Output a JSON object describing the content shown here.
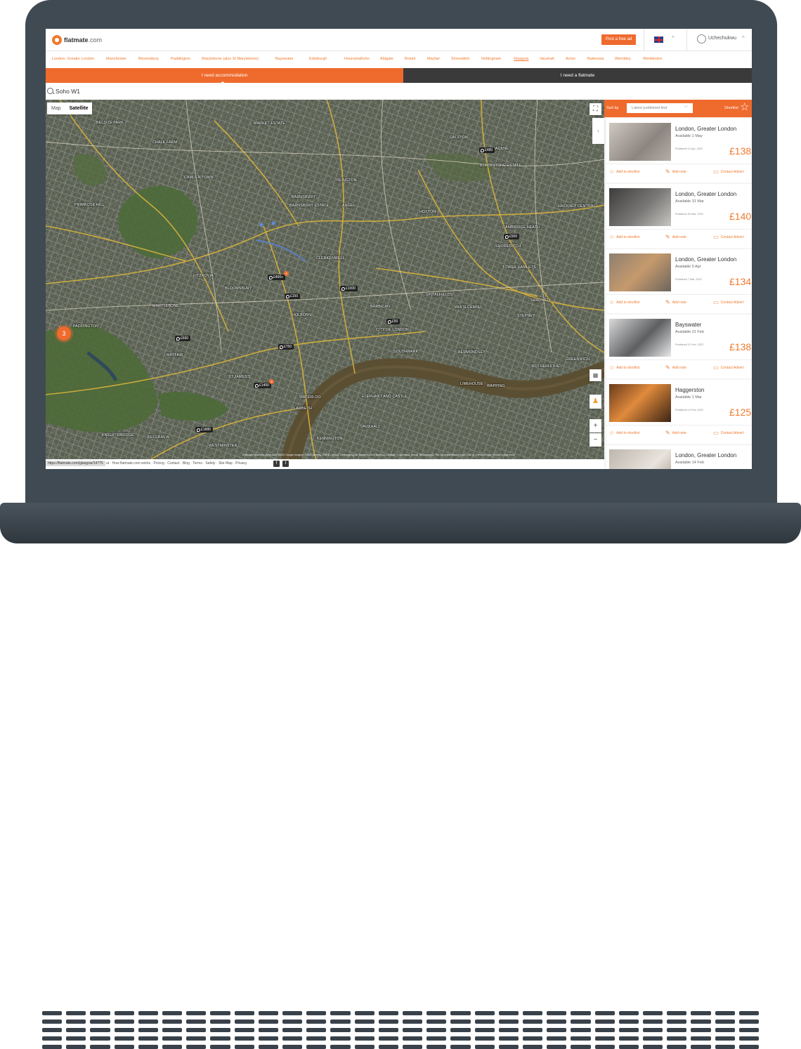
{
  "header": {
    "logo_text": "flatmate",
    "logo_suffix": ".com",
    "post_ad_label": "Post a free ad",
    "user_name": "Uchechukwu"
  },
  "cities": [
    "London, Greater London",
    "Manchester",
    "Bloomsbury",
    "Paddington",
    "Marylebone (also St Marylebone)",
    "Bayswater",
    "Edinburgh",
    "Hounslow",
    "Soho",
    "Aldgate",
    "Bristol",
    "Mayfair",
    "Shoreditch",
    "Nottingham",
    "Glasgow",
    "Vauxhall",
    "Acton",
    "Battersea",
    "Wembley",
    "Wimbledon"
  ],
  "tabs": {
    "accommodation": "I need accommodation",
    "flatmate": "I need a flatmate"
  },
  "search": {
    "value": "Soho  W1"
  },
  "map": {
    "type_map": "Map",
    "type_satellite": "Satellite",
    "cluster_count": "3",
    "zoom_in": "+",
    "zoom_out": "−",
    "labels": [
      "BELSIZE PARK",
      "MARKET ESTATE",
      "CHALK FARM",
      "DALSTON",
      "HACKNE",
      "CAMDEN TOWN",
      "BARNSBURY",
      "ISLINGTON",
      "PRIMROSE HILL",
      "CAMBRIDGE HEATH",
      "BARNSBURY ESTATE",
      "ANGEL",
      "HOXTON",
      "BLACKSTONE ESTATE",
      "SHOREDITCH",
      "CLERKENWELL",
      "FITZROVIA",
      "BLOOMSBURY",
      "MARYLEBONE",
      "HOLBORN",
      "BARBICAN",
      "SPITALFIELDS",
      "WHITECHAPEL",
      "STEPNEY",
      "PADDINGTON",
      "MAYFAIR",
      "ST JAMES'S",
      "SOUTHWARK",
      "BERMONDSEY",
      "ROTHERHITHE",
      "WATERLOO",
      "LAMBETH",
      "KNIGHTSBRIDGE",
      "BELGRAVIA",
      "KENNINGTON",
      "VAUXHALL",
      "WESTMINSTER",
      "LIMEHOUSE",
      "WAPPING",
      "CITY OF LONDON",
      "ELEPHANT AND CASTLE",
      "TOWER HAMLETS",
      "SHADWELL",
      "GREENWICH",
      "HACKNEY CENTRAL"
    ],
    "pins": [
      "£480",
      "£500",
      "£400+",
      "£1000",
      "£150",
      "£50",
      "£690",
      "£750",
      "£1400",
      "£1880"
    ],
    "pin_badges": [
      "9",
      "8"
    ],
    "attribution": "Keyboard shortcuts  |  Map data ©2022 Google  Imagery ©2022  Bluesky, CNES / Airbus, Getmapping plc, Infoterra Ltd & Bluesky, Landsat / Copernicus, Maxar Technologies, The GeoInformation Group  |  200 m  |  Terms of Use  |  Report a map error"
  },
  "footer": {
    "status_url": "https://flatmate.com/glasgow/14775",
    "links": "ut  ·  How flatmate.com works  ·  Pricing  ·  Contact  ·  Blog  ·  Terms  ·  Safety  ·  Site Map  ·  Privacy"
  },
  "sidebar": {
    "sort_by": "Sort by",
    "sort_value": "Latest published first",
    "shortlist_label": "Shortlist",
    "collapse": "‹",
    "action_shortlist": "Add to shortlist",
    "action_note": "Add note",
    "action_contact": "Contact Advert",
    "listings": [
      {
        "title": "London, Greater London",
        "available": "Available 1 May",
        "published": "Published 12 Apr, 2022",
        "price": "£138"
      },
      {
        "title": "London, Greater London",
        "available": "Available 31 Mar",
        "published": "Published 30 Mar, 2022",
        "price": "£140"
      },
      {
        "title": "London, Greater London",
        "available": "Available 5 Apr",
        "published": "Published 7 Mar, 2022",
        "price": "£134"
      },
      {
        "title": "Bayswater",
        "available": "Available 21 Feb",
        "published": "Published 21 Feb, 2022",
        "price": "£138"
      },
      {
        "title": "Haggerston",
        "available": "Available 1 Mar",
        "published": "Published 14 Feb, 2022",
        "price": "£125"
      },
      {
        "title": "London, Greater London",
        "available": "Available 14 Feb",
        "published": "",
        "price": ""
      }
    ]
  },
  "colors": {
    "accent": "#ef6a2d",
    "dark_tab": "#3a3a3a",
    "laptop": "#3f4a53"
  }
}
